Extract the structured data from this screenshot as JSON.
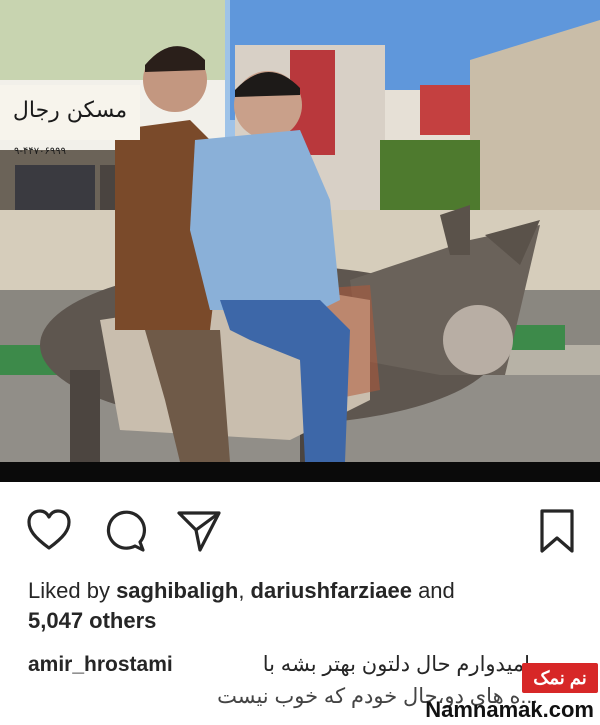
{
  "post": {
    "photo_alt": "Two men riding a donkey on a street",
    "shop_sign": "مسکن رجال",
    "shop_phone": "۹-۴۴۷۰۶۹۹۹"
  },
  "actions": {
    "like_icon": "heart-icon",
    "comment_icon": "comment-icon",
    "share_icon": "send-icon",
    "save_icon": "bookmark-icon"
  },
  "likes": {
    "prefix": "Liked by ",
    "user1": "saghibaligh",
    "sep": ", ",
    "user2": "dariushfarziaee",
    "and": " and",
    "others": "5,047 others"
  },
  "caption": {
    "username": "amir_hrostami",
    "line1": "امیدوارم حال دلتون بهتر بشه با",
    "line2": "...ه های دو،حال خودم که خوب نیست"
  },
  "watermark": {
    "badge": "نم نمک",
    "site": "Namnamak.com"
  },
  "colors": {
    "text": "#262626",
    "badge": "#d72727"
  }
}
